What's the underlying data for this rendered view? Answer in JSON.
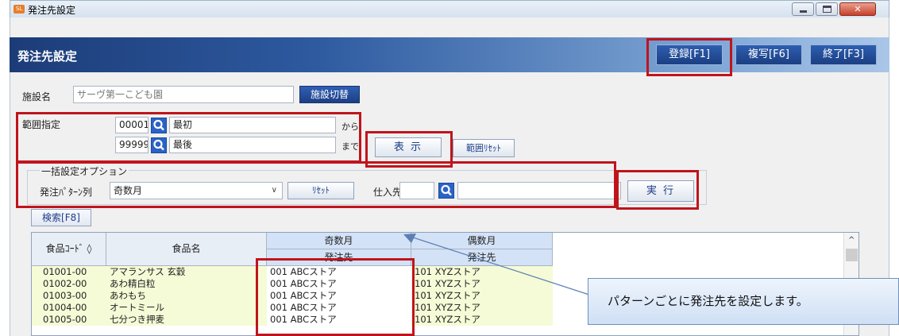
{
  "window": {
    "title": "発注先設定",
    "app_icon": "app-icon"
  },
  "header": {
    "title": "発注先設定",
    "buttons": {
      "register": "登録[F1]",
      "copy": "複写[F6]",
      "exit": "終了[F3]"
    }
  },
  "facility": {
    "label": "施設名",
    "value": "サーヴ第一こども園",
    "switch_button": "施設切替"
  },
  "range": {
    "label": "範囲指定",
    "from_code": "00001",
    "from_name": "最初",
    "from_suffix": "から",
    "to_code": "99999",
    "to_name": "最後",
    "to_suffix": "まで",
    "show_button": "表 示",
    "reset_button": "範囲ﾘｾｯﾄ"
  },
  "bulk": {
    "group_label": "一括設定オプション",
    "pattern_label": "発注ﾊﾟﾀｰﾝ列",
    "pattern_value": "奇数月",
    "reset_button": "ﾘｾｯﾄ",
    "supplier_label": "仕入先",
    "supplier_code": "",
    "supplier_name": "",
    "execute_button": "実 行"
  },
  "search_button": "検索[F8]",
  "grid": {
    "columns": {
      "code": "食品ｺｰﾄﾞ ◊",
      "name": "食品名",
      "odd_month": "奇数月",
      "odd_sub": "発注先",
      "even_month": "偶数月",
      "even_sub": "発注先"
    },
    "rows": [
      {
        "code": "01001-00",
        "name": "アマランサス 玄穀",
        "odd": "001  ABCストア",
        "even": "101  XYZストア"
      },
      {
        "code": "01002-00",
        "name": "あわ精白粒",
        "odd": "001  ABCストア",
        "even": "101  XYZストア"
      },
      {
        "code": "01003-00",
        "name": "あわもち",
        "odd": "001  ABCストア",
        "even": "101  XYZストア"
      },
      {
        "code": "01004-00",
        "name": "オートミール",
        "odd": "001  ABCストア",
        "even": "101  XYZストア"
      },
      {
        "code": "01005-00",
        "name": "七分つき押麦",
        "odd": "001  ABCストア",
        "even": "101  XYZストア"
      }
    ]
  },
  "callout": {
    "text": "パターンごとに発注先を設定します。"
  },
  "colors": {
    "highlight": "#c0141c",
    "header_dark": "#1c3c78",
    "row_fill": "#f5fbd6"
  }
}
